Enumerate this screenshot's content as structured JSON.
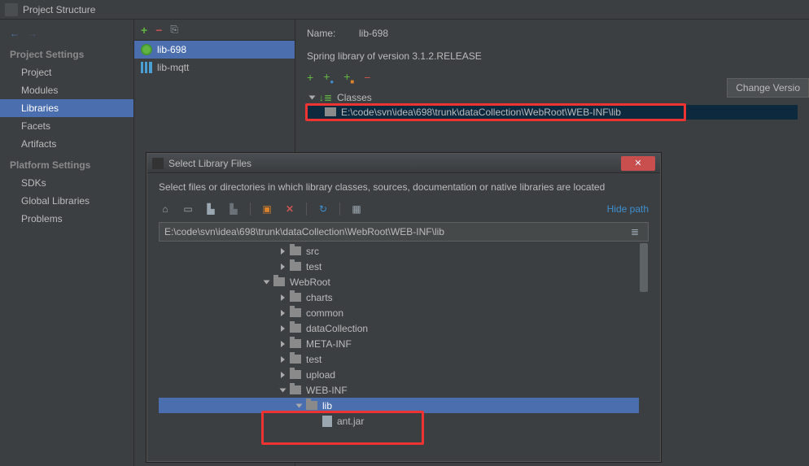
{
  "window_title": "Project Structure",
  "sidebar": {
    "sections": [
      {
        "header": "Project Settings",
        "items": [
          "Project",
          "Modules",
          "Libraries",
          "Facets",
          "Artifacts"
        ],
        "selected": "Libraries"
      },
      {
        "header": "Platform Settings",
        "items": [
          "SDKs",
          "Global Libraries"
        ]
      },
      {
        "header": "",
        "items": [
          "Problems"
        ]
      }
    ]
  },
  "libraries": {
    "items": [
      {
        "name": "lib-698",
        "icon": "spring",
        "selected": true
      },
      {
        "name": "lib-mqtt",
        "icon": "bars",
        "selected": false
      }
    ]
  },
  "detail": {
    "name_label": "Name:",
    "name_value": "lib-698",
    "subtitle": "Spring library of version 3.1.2.RELEASE",
    "change_button": "Change Versio",
    "classes_label": "Classes",
    "classes_path": "E:\\code\\svn\\idea\\698\\trunk\\dataCollection\\WebRoot\\WEB-INF\\lib"
  },
  "dialog": {
    "title": "Select Library Files",
    "message": "Select files or directories in which library classes, sources, documentation or native libraries are located",
    "hide_path": "Hide path",
    "path_value": "E:\\code\\svn\\idea\\698\\trunk\\dataCollection\\WebRoot\\WEB-INF\\lib",
    "tree": [
      {
        "indent": 150,
        "caret": "closed",
        "type": "folder",
        "label": "src"
      },
      {
        "indent": 150,
        "caret": "closed",
        "type": "folder",
        "label": "test"
      },
      {
        "indent": 130,
        "caret": "open",
        "type": "folder",
        "label": "WebRoot"
      },
      {
        "indent": 150,
        "caret": "closed",
        "type": "folder",
        "label": "charts"
      },
      {
        "indent": 150,
        "caret": "closed",
        "type": "folder",
        "label": "common"
      },
      {
        "indent": 150,
        "caret": "closed",
        "type": "folder",
        "label": "dataCollection"
      },
      {
        "indent": 150,
        "caret": "closed",
        "type": "folder",
        "label": "META-INF"
      },
      {
        "indent": 150,
        "caret": "closed",
        "type": "folder",
        "label": "test"
      },
      {
        "indent": 150,
        "caret": "closed",
        "type": "folder",
        "label": "upload"
      },
      {
        "indent": 150,
        "caret": "open",
        "type": "folder",
        "label": "WEB-INF"
      },
      {
        "indent": 170,
        "caret": "open",
        "type": "folder",
        "label": "lib",
        "selected": true
      },
      {
        "indent": 190,
        "caret": "none",
        "type": "file",
        "label": "ant.jar"
      }
    ]
  }
}
